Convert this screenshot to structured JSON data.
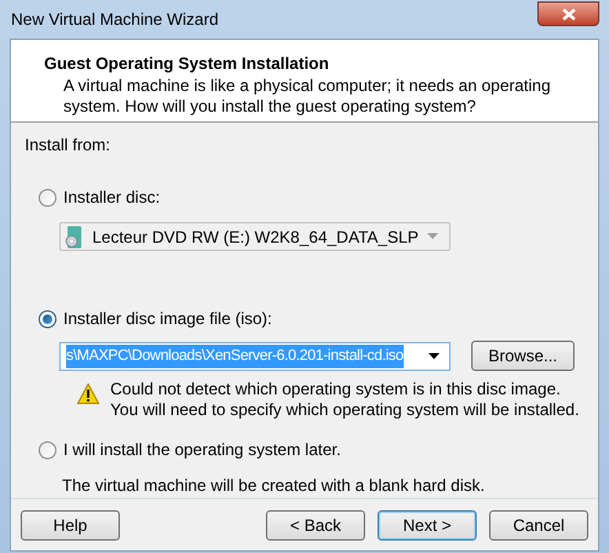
{
  "window": {
    "title": "New Virtual Machine Wizard"
  },
  "header": {
    "title": "Guest Operating System Installation",
    "description": "A virtual machine is like a physical computer; it needs an operating system. How will you install the guest operating system?"
  },
  "install_from_label": "Install from:",
  "options": [
    {
      "kind": "disc",
      "label": "Installer disc:",
      "selected": false,
      "value": "Lecteur DVD RW (E:) W2K8_64_DATA_SLP",
      "disabled": true
    },
    {
      "kind": "iso",
      "label": "Installer disc image file (iso):",
      "selected": true,
      "value": "s\\MAXPC\\Downloads\\XenServer-6.0.201-install-cd.iso",
      "browse": "Browse...",
      "warning": [
        "Could not detect which operating system is in this disc image.",
        "You will need to specify which operating system will be installed."
      ]
    },
    {
      "kind": "later",
      "label": "I will install the operating system later.",
      "selected": false,
      "note": "The virtual machine will be created with a blank hard disk."
    }
  ],
  "buttons": [
    {
      "label": "Help",
      "default": false
    },
    {
      "label": "< Back",
      "default": false
    },
    {
      "label": "Next >",
      "default": true
    },
    {
      "label": "Cancel",
      "default": false
    }
  ]
}
